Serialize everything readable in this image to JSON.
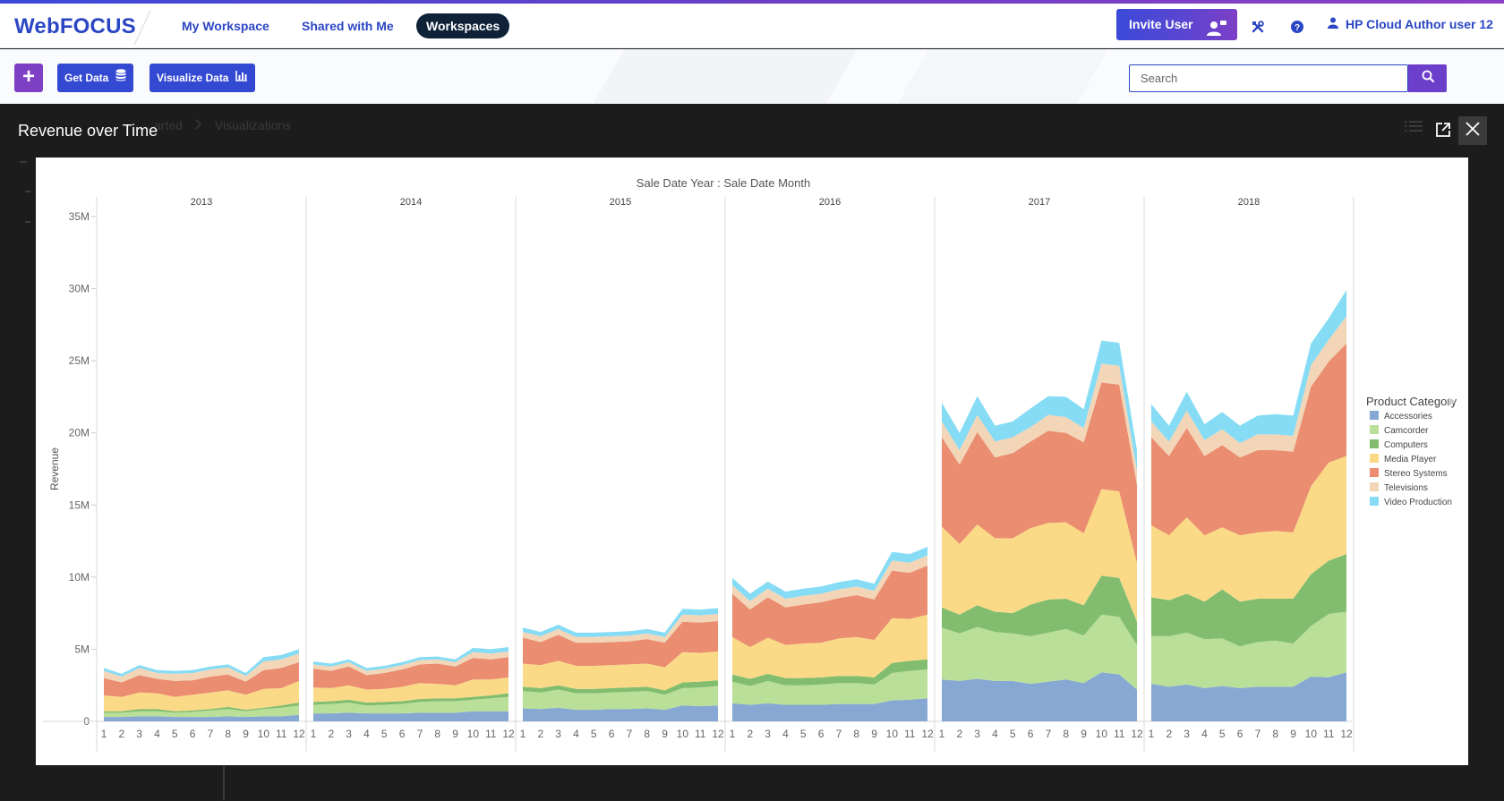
{
  "header": {
    "logo": "WebFOCUS",
    "nav": [
      {
        "label": "My Workspace"
      },
      {
        "label": "Shared with Me"
      },
      {
        "label": "Workspaces"
      }
    ],
    "invite_label": "Invite User",
    "user_name": "HP Cloud Author user 12"
  },
  "toolbar": {
    "plus_label": "+",
    "get_data_label": "Get Data",
    "visualize_label": "Visualize Data",
    "search_placeholder": "Search"
  },
  "background_breadcrumb": {
    "item1": "arted",
    "item2": "Visualizations"
  },
  "modal": {
    "title": "Revenue over Time"
  },
  "colors": {
    "accent": "#2b46c4",
    "purple": "#7d3fc4",
    "Accessories": "#86a8d2",
    "Camcorder": "#b9df99",
    "Computers": "#82bd6f",
    "Media Player": "#fbda87",
    "Stereo Systems": "#ea8d70",
    "Televisions": "#f3d6b8",
    "Video Production": "#86dcf5"
  },
  "chart_data": {
    "type": "area",
    "stacked": true,
    "title": "Sale Date Year : Sale Date Month",
    "ylabel": "Revenue",
    "ylim": [
      0,
      35000000
    ],
    "yticks": [
      "0",
      "5M",
      "10M",
      "15M",
      "20M",
      "25M",
      "30M",
      "35M"
    ],
    "panels": [
      "2013",
      "2014",
      "2015",
      "2016",
      "2017",
      "2018"
    ],
    "months": [
      "1",
      "2",
      "3",
      "4",
      "5",
      "6",
      "7",
      "8",
      "9",
      "10",
      "11",
      "12"
    ],
    "legend_title": "Product Category",
    "series": [
      {
        "name": "Accessories",
        "color": "#86a8d2",
        "values": [
          [
            0.3,
            0.3,
            0.35,
            0.35,
            0.3,
            0.3,
            0.3,
            0.35,
            0.3,
            0.35,
            0.35,
            0.45
          ],
          [
            0.55,
            0.55,
            0.6,
            0.55,
            0.55,
            0.55,
            0.6,
            0.6,
            0.6,
            0.7,
            0.7,
            0.7
          ],
          [
            0.9,
            0.85,
            0.95,
            0.8,
            0.8,
            0.85,
            0.85,
            0.9,
            0.8,
            1.1,
            1.05,
            1.1
          ],
          [
            1.25,
            1.15,
            1.25,
            1.15,
            1.15,
            1.15,
            1.2,
            1.2,
            1.2,
            1.45,
            1.5,
            1.6
          ],
          [
            2.9,
            2.8,
            2.95,
            2.8,
            2.8,
            2.6,
            2.75,
            2.9,
            2.65,
            3.4,
            3.25,
            2.2
          ],
          [
            2.6,
            2.4,
            2.55,
            2.3,
            2.45,
            2.3,
            2.4,
            2.4,
            2.4,
            3.1,
            3.05,
            3.4
          ]
        ]
      },
      {
        "name": "Camcorder",
        "color": "#b9df99",
        "values": [
          [
            0.3,
            0.3,
            0.35,
            0.35,
            0.3,
            0.35,
            0.45,
            0.5,
            0.4,
            0.5,
            0.6,
            0.65
          ],
          [
            0.6,
            0.65,
            0.7,
            0.55,
            0.6,
            0.65,
            0.75,
            0.8,
            0.8,
            0.8,
            0.9,
            1.0
          ],
          [
            1.2,
            1.15,
            1.25,
            1.15,
            1.15,
            1.15,
            1.2,
            1.2,
            1.05,
            1.2,
            1.3,
            1.35
          ],
          [
            1.5,
            1.3,
            1.55,
            1.35,
            1.35,
            1.4,
            1.45,
            1.45,
            1.35,
            1.9,
            2.0,
            2.0
          ],
          [
            3.6,
            3.3,
            3.6,
            3.4,
            3.3,
            3.3,
            3.4,
            3.5,
            3.3,
            4.0,
            4.0,
            3.1
          ],
          [
            3.3,
            3.5,
            3.6,
            3.4,
            3.3,
            2.9,
            3.1,
            3.2,
            3.0,
            3.5,
            4.4,
            4.2
          ]
        ]
      },
      {
        "name": "Computers",
        "color": "#82bd6f",
        "values": [
          [
            0.1,
            0.1,
            0.15,
            0.15,
            0.1,
            0.1,
            0.1,
            0.15,
            0.1,
            0.1,
            0.15,
            0.2
          ],
          [
            0.2,
            0.2,
            0.2,
            0.2,
            0.2,
            0.2,
            0.2,
            0.2,
            0.2,
            0.2,
            0.2,
            0.25
          ],
          [
            0.3,
            0.3,
            0.3,
            0.3,
            0.3,
            0.3,
            0.3,
            0.3,
            0.3,
            0.4,
            0.4,
            0.4
          ],
          [
            0.5,
            0.5,
            0.5,
            0.5,
            0.5,
            0.5,
            0.5,
            0.5,
            0.5,
            0.7,
            0.7,
            0.7
          ],
          [
            1.4,
            1.3,
            1.5,
            1.4,
            1.4,
            2.2,
            2.3,
            2.1,
            2.1,
            2.7,
            2.7,
            1.6
          ],
          [
            2.7,
            2.5,
            2.7,
            2.6,
            3.4,
            3.1,
            3.0,
            2.9,
            3.1,
            3.6,
            3.7,
            4.0
          ]
        ]
      },
      {
        "name": "Media Player",
        "color": "#fbda87",
        "values": [
          [
            1.1,
            1.0,
            1.15,
            1.1,
            1.0,
            1.1,
            1.15,
            1.15,
            1.05,
            1.3,
            1.2,
            1.5
          ],
          [
            1.0,
            0.9,
            1.0,
            0.9,
            0.9,
            1.0,
            1.1,
            1.0,
            0.9,
            1.2,
            1.1,
            1.1
          ],
          [
            1.6,
            1.6,
            1.7,
            1.6,
            1.6,
            1.6,
            1.6,
            1.6,
            1.6,
            2.1,
            2.0,
            2.0
          ],
          [
            2.6,
            2.2,
            2.5,
            2.3,
            2.4,
            2.4,
            2.6,
            2.7,
            2.6,
            3.1,
            2.9,
            3.1
          ],
          [
            5.6,
            4.9,
            5.6,
            5.1,
            5.2,
            5.3,
            5.3,
            5.3,
            5.0,
            6.0,
            6.0,
            4.1
          ],
          [
            5.0,
            4.5,
            5.3,
            4.6,
            4.3,
            4.6,
            4.6,
            4.7,
            4.6,
            6.1,
            6.8,
            6.8
          ]
        ]
      },
      {
        "name": "Stereo Systems",
        "color": "#ea8d70",
        "values": [
          [
            1.2,
            1.0,
            1.2,
            1.0,
            1.1,
            1.0,
            1.1,
            1.1,
            0.9,
            1.3,
            1.4,
            1.3
          ],
          [
            1.3,
            1.2,
            1.3,
            1.0,
            1.1,
            1.2,
            1.3,
            1.4,
            1.3,
            1.5,
            1.4,
            1.4
          ],
          [
            1.8,
            1.6,
            1.8,
            1.6,
            1.6,
            1.6,
            1.6,
            1.7,
            1.7,
            2.1,
            2.1,
            2.1
          ],
          [
            3.0,
            2.6,
            2.8,
            2.6,
            2.7,
            2.8,
            2.8,
            2.9,
            2.8,
            3.3,
            3.2,
            3.4
          ],
          [
            6.2,
            5.5,
            6.4,
            5.6,
            5.9,
            6.0,
            6.4,
            6.2,
            6.3,
            7.4,
            7.4,
            5.4
          ],
          [
            6.1,
            5.5,
            6.2,
            5.5,
            5.7,
            5.4,
            5.7,
            5.6,
            5.6,
            6.9,
            7.0,
            7.8
          ]
        ]
      },
      {
        "name": "Televisions",
        "color": "#f3d6b8",
        "values": [
          [
            0.5,
            0.4,
            0.5,
            0.4,
            0.5,
            0.5,
            0.5,
            0.5,
            0.4,
            0.6,
            0.6,
            0.6
          ],
          [
            0.3,
            0.3,
            0.3,
            0.3,
            0.3,
            0.3,
            0.3,
            0.3,
            0.3,
            0.4,
            0.4,
            0.4
          ],
          [
            0.4,
            0.4,
            0.4,
            0.4,
            0.4,
            0.4,
            0.4,
            0.4,
            0.4,
            0.5,
            0.5,
            0.5
          ],
          [
            0.6,
            0.6,
            0.6,
            0.6,
            0.6,
            0.6,
            0.6,
            0.6,
            0.6,
            0.7,
            0.7,
            0.7
          ],
          [
            1.1,
            1.0,
            1.2,
            1.1,
            1.1,
            1.0,
            1.1,
            1.1,
            1.0,
            1.3,
            1.3,
            1.0
          ],
          [
            1.1,
            1.0,
            1.2,
            1.1,
            1.1,
            1.0,
            1.1,
            1.1,
            1.1,
            1.5,
            1.5,
            1.9
          ]
        ]
      },
      {
        "name": "Video Production",
        "color": "#86dcf5",
        "values": [
          [
            0.2,
            0.2,
            0.2,
            0.2,
            0.2,
            0.2,
            0.2,
            0.2,
            0.2,
            0.3,
            0.3,
            0.3
          ],
          [
            0.2,
            0.2,
            0.2,
            0.2,
            0.2,
            0.2,
            0.2,
            0.2,
            0.2,
            0.3,
            0.3,
            0.3
          ],
          [
            0.3,
            0.3,
            0.3,
            0.3,
            0.3,
            0.3,
            0.3,
            0.3,
            0.3,
            0.4,
            0.4,
            0.4
          ],
          [
            0.5,
            0.5,
            0.5,
            0.5,
            0.5,
            0.5,
            0.5,
            0.5,
            0.5,
            0.6,
            0.6,
            0.6
          ],
          [
            1.3,
            1.2,
            1.3,
            1.1,
            1.1,
            1.3,
            1.3,
            1.4,
            1.3,
            1.6,
            1.6,
            1.4
          ],
          [
            1.2,
            1.1,
            1.3,
            1.1,
            1.2,
            1.2,
            1.3,
            1.4,
            1.4,
            1.5,
            1.5,
            1.8
          ]
        ]
      }
    ]
  }
}
